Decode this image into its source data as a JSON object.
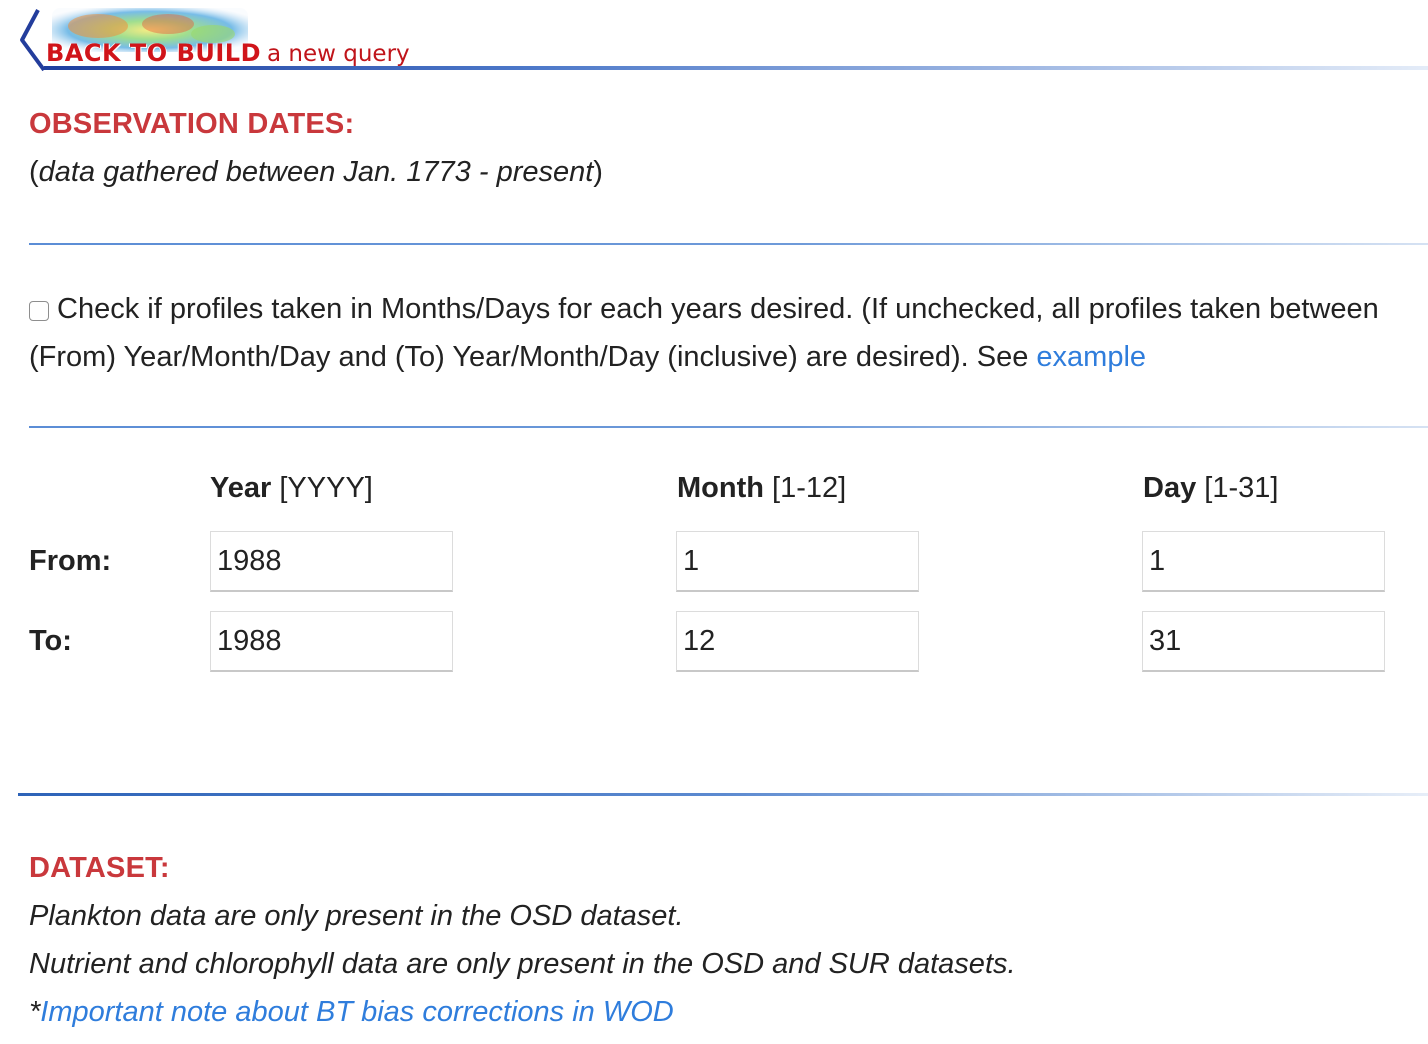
{
  "back_link": {
    "main": "BACK TO BUILD",
    "tail": "a new query"
  },
  "observation": {
    "heading": "OBSERVATION DATES:",
    "range_open": "(",
    "range_text": "data gathered between Jan. 1773 - present",
    "range_close": ")"
  },
  "month_day_option": {
    "text": "Check if profiles taken in Months/Days for each years desired. (If unchecked, all profiles taken between (From) Year/Month/Day and (To) Year/Month/Day (inclusive) are desired). See ",
    "link": "example",
    "checked": false
  },
  "date_grid": {
    "columns": [
      {
        "label": "Year",
        "hint": "[YYYY]"
      },
      {
        "label": "Month",
        "hint": "[1-12]"
      },
      {
        "label": "Day",
        "hint": "[1-31]"
      }
    ],
    "rows": [
      {
        "label": "From:",
        "year": "1988",
        "month": "1",
        "day": "1"
      },
      {
        "label": "To:",
        "year": "1988",
        "month": "12",
        "day": "31"
      }
    ]
  },
  "dataset": {
    "heading": "DATASET:",
    "note1": "Plankton data are only present in the OSD dataset.",
    "note2": "Nutrient and chlorophyll data are only present in the OSD and SUR datasets.",
    "asterisk": "*",
    "bt_link": "Important note about BT bias corrections in WOD"
  },
  "colors": {
    "heading_red": "#c9383c",
    "link_blue": "#2f7ddc",
    "rule_blue": "#5b8dd6"
  }
}
